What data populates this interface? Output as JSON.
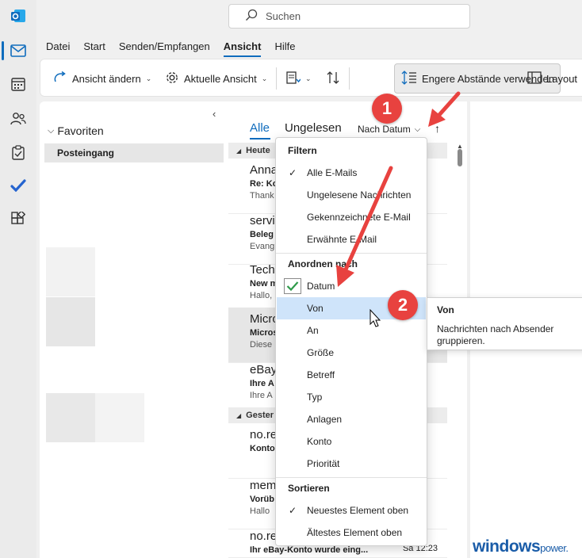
{
  "search": {
    "placeholder": "Suchen"
  },
  "menu": {
    "tabs": [
      "Datei",
      "Start",
      "Senden/Empfangen",
      "Ansicht",
      "Hilfe"
    ],
    "selected": "Ansicht"
  },
  "ribbon": {
    "change_view": "Ansicht ändern",
    "current_view": "Aktuelle Ansicht",
    "tighter_spacing": "Engere Abstände verwenden",
    "layout": "Layout"
  },
  "folders": {
    "favorites": "Favoriten",
    "inbox": "Posteingang"
  },
  "list": {
    "tab_all": "Alle",
    "tab_unread": "Ungelesen",
    "sort_label": "Nach Datum",
    "groups": [
      "Heute",
      "Gester"
    ],
    "messages": [
      {
        "sender": "Anna",
        "subject": "Re: Ko",
        "preview": "Thank",
        "time": ""
      },
      {
        "sender": "servic",
        "subject": "Beleg f",
        "preview": "Evang",
        "time": ""
      },
      {
        "sender": "Tech",
        "subject": "New m",
        "preview": "Hallo,",
        "time": ""
      },
      {
        "sender": "Micro",
        "subject": "Micros",
        "preview": "Diese",
        "time": ""
      },
      {
        "sender": "eBay",
        "subject": "Ihre A",
        "preview": "Ihre A",
        "time": ""
      },
      {
        "sender": "no.re",
        "subject": "Konto",
        "preview": "",
        "time": ""
      },
      {
        "sender": "mem",
        "subject": "Vorüb",
        "preview": "Hallo",
        "time": ""
      },
      {
        "sender": "no.re",
        "subject": "Ihr eBay-Konto wurde eing...",
        "preview": "",
        "time": "Sa 12:23"
      }
    ]
  },
  "dropdown": {
    "filter_heading": "Filtern",
    "filter_items": [
      "Alle E-Mails",
      "Ungelesene Nachrichten",
      "Gekennzeichnete E-Mail",
      "Erwähnte E-Mail"
    ],
    "arrange_heading": "Anordnen nach",
    "arrange_items": [
      "Datum",
      "Von",
      "An",
      "Größe",
      "Betreff",
      "Typ",
      "Anlagen",
      "Konto",
      "Priorität"
    ],
    "sort_heading": "Sortieren",
    "sort_items": [
      "Neuestes Element oben",
      "Ältestes Element oben"
    ]
  },
  "tooltip": {
    "title": "Von",
    "description": "Nachrichten nach Absender gruppieren."
  },
  "badges": {
    "first": "1",
    "second": "2"
  },
  "watermark": {
    "brand": "windows",
    "suffix": "power."
  },
  "colors": {
    "accent": "#0f6cbd",
    "badge": "#e8423f",
    "highlight": "#cfe4fa"
  }
}
